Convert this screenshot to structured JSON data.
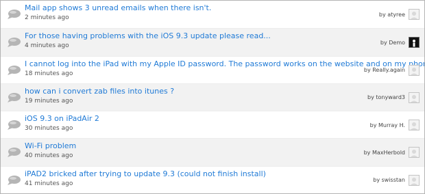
{
  "threads": [
    {
      "title": "Mail app shows 3 unread emails when there isn't.",
      "time": "2 minutes ago",
      "author": "by atyree",
      "avatar_icon": "default-avatar-icon"
    },
    {
      "title": "For those having problems with the iOS 9.3 update please read...",
      "time": "4 minutes ago",
      "author": "by Demo",
      "avatar_icon": "dark-user-avatar-icon"
    },
    {
      "title": "I cannot log into the iPad with my Apple ID password. The password works on the website and on my phone.",
      "time": "18 minutes ago",
      "author": "by Really.again",
      "avatar_icon": "default-avatar-icon"
    },
    {
      "title": "how can i convert zab files into itunes ?",
      "time": "19 minutes ago",
      "author": "by tonyward3",
      "avatar_icon": "default-avatar-icon"
    },
    {
      "title": "iOS 9.3 on iPadAir 2",
      "time": "30 minutes ago",
      "author": "by Murray H.",
      "avatar_icon": "default-avatar-icon"
    },
    {
      "title": "Wi-Fi problem",
      "time": "40 minutes ago",
      "author": "by MaxHerbold",
      "avatar_icon": "default-avatar-icon"
    },
    {
      "title": "iPAD2 bricked after trying to update 9.3 (could not finish install)",
      "time": "41 minutes ago",
      "author": "by swisstan",
      "avatar_icon": "default-avatar-icon"
    }
  ],
  "colors": {
    "title_link": "#1f7ad6",
    "meta_text": "#555555",
    "row_alt_background": "#f2f2f2",
    "bubble_icon": "#b5b5b5"
  }
}
